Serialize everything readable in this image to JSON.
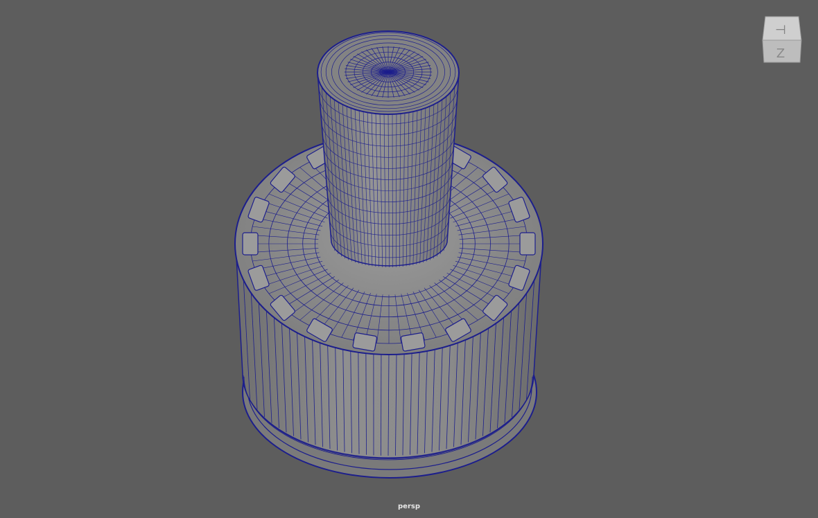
{
  "viewport": {
    "camera_name": "persp",
    "background_color": "#5d5d5d",
    "wireframe_color": "#1c1e8c",
    "surface_color": "#8c8c8c"
  },
  "viewcube": {
    "top_face_glyph": "⊣",
    "front_face_glyph": "Z"
  },
  "model": {
    "description_icon": "mesh-object-icon",
    "bump_count": 18
  }
}
